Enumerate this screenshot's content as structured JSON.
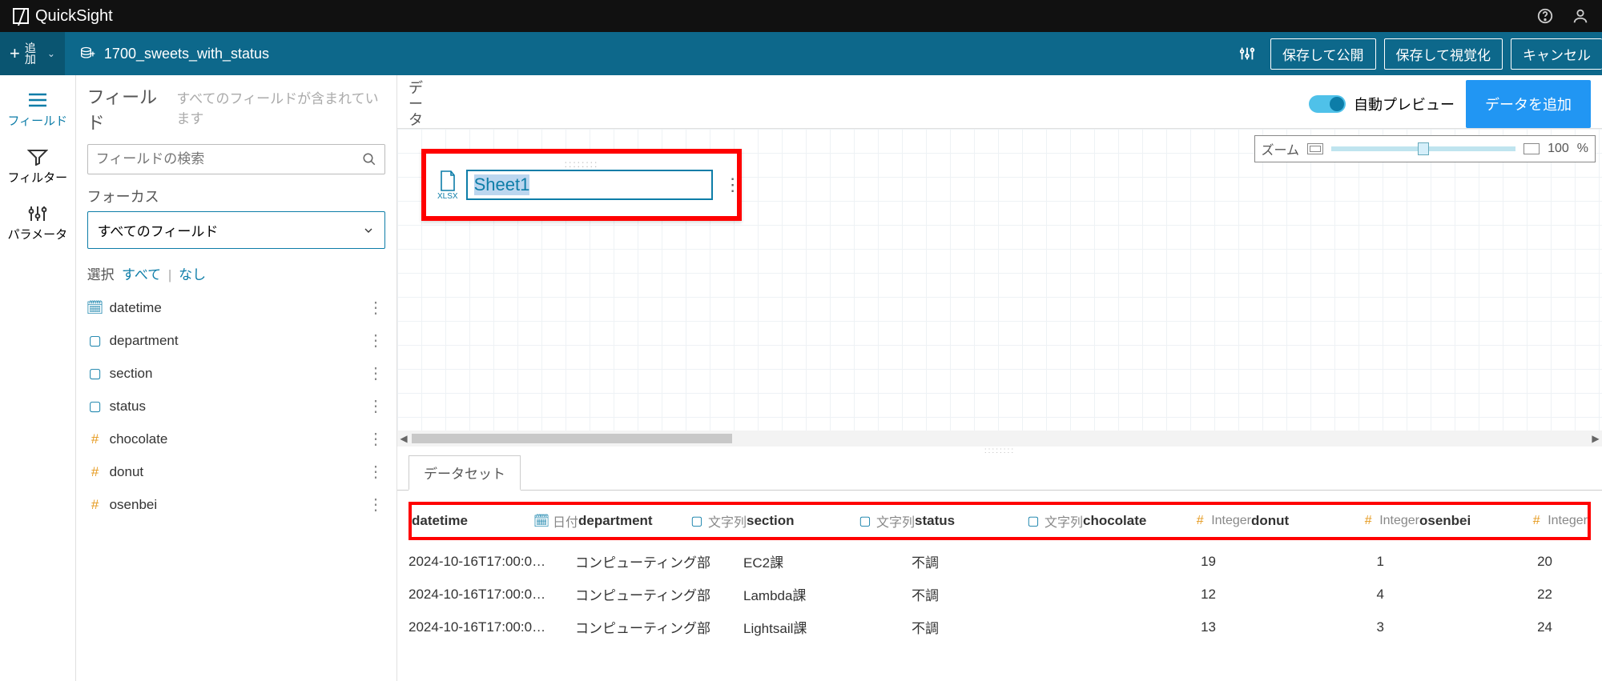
{
  "app": {
    "name": "QuickSight"
  },
  "bluebar": {
    "add_label_1": "追",
    "add_label_2": "加",
    "dataset_name": "1700_sweets_with_status",
    "save_publish": "保存して公開",
    "save_visualize": "保存して視覚化",
    "cancel": "キャンセル"
  },
  "rail": {
    "fields": "フィールド",
    "filters": "フィルター",
    "params": "パラメータ"
  },
  "fields_panel": {
    "title": "フィールド",
    "subtitle": "すべてのフィールドが含まれています",
    "search_placeholder": "フィールドの検索",
    "focus_label": "フォーカス",
    "focus_value": "すべてのフィールド",
    "select_label": "選択",
    "select_all": "すべて",
    "select_none": "なし",
    "items": [
      {
        "name": "datetime",
        "icon": "cal"
      },
      {
        "name": "department",
        "icon": "str"
      },
      {
        "name": "section",
        "icon": "str"
      },
      {
        "name": "status",
        "icon": "str"
      },
      {
        "name": "chocolate",
        "icon": "num"
      },
      {
        "name": "donut",
        "icon": "num"
      },
      {
        "name": "osenbei",
        "icon": "num"
      }
    ]
  },
  "canvas": {
    "data_label": "データ",
    "auto_preview": "自動プレビュー",
    "add_data": "データを追加",
    "zoom_label": "ズーム",
    "zoom_val": "100",
    "zoom_pct": "%",
    "node_ext": "XLSX",
    "node_name": "Sheet1"
  },
  "table": {
    "dataset_tab": "データセット",
    "date_type": "日付",
    "string_type": "文字列",
    "int_type": "Integer",
    "columns": [
      "datetime",
      "department",
      "section",
      "status",
      "chocolate",
      "donut",
      "osenbei"
    ],
    "rows": [
      {
        "datetime": "2024-10-16T17:00:0…",
        "department": "コンピューティング部",
        "section": "EC2課",
        "status": "不調",
        "chocolate": "19",
        "donut": "1",
        "osenbei": "20"
      },
      {
        "datetime": "2024-10-16T17:00:0…",
        "department": "コンピューティング部",
        "section": "Lambda課",
        "status": "不調",
        "chocolate": "12",
        "donut": "4",
        "osenbei": "22"
      },
      {
        "datetime": "2024-10-16T17:00:0…",
        "department": "コンピューティング部",
        "section": "Lightsail課",
        "status": "不調",
        "chocolate": "13",
        "donut": "3",
        "osenbei": "24"
      }
    ]
  }
}
